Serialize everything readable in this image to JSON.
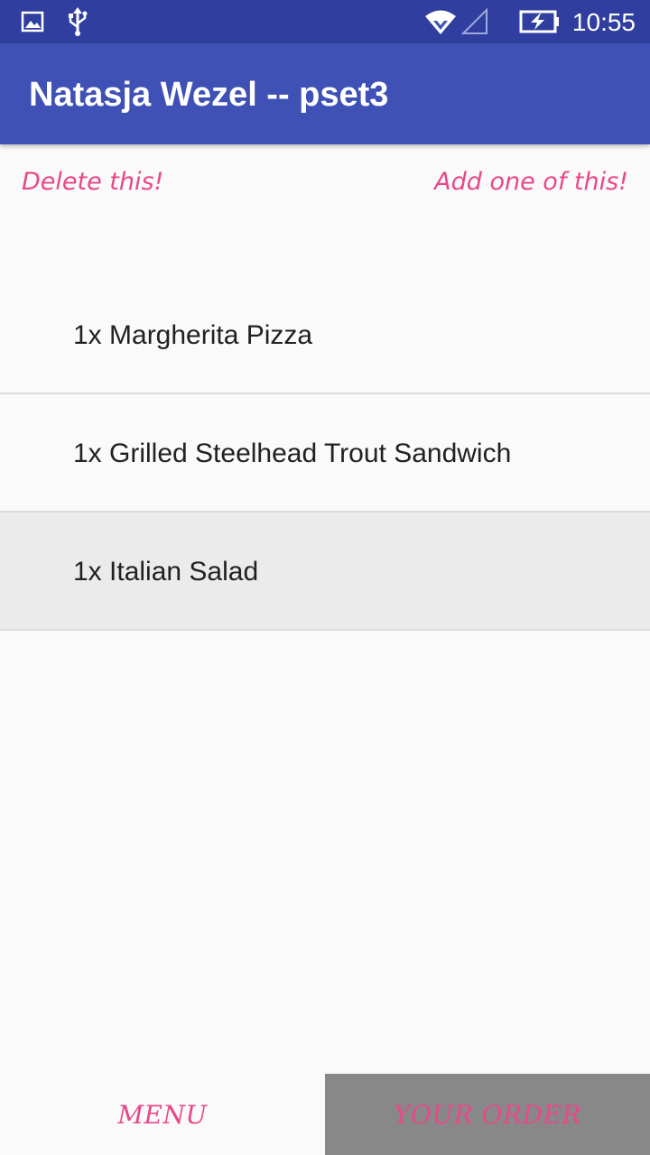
{
  "status_bar": {
    "time": "10:55",
    "icons": [
      "image-icon",
      "usb-icon",
      "wifi-icon",
      "signal-icon",
      "battery-charging-icon"
    ]
  },
  "app_bar": {
    "title": "Natasja Wezel -- pset3"
  },
  "hints": {
    "delete": "Delete this!",
    "add": "Add one of this!"
  },
  "order_list": {
    "items": [
      {
        "label": "1x Margherita Pizza"
      },
      {
        "label": "1x Grilled Steelhead Trout Sandwich"
      },
      {
        "label": "1x Italian Salad"
      }
    ]
  },
  "bottom_nav": {
    "menu_label": "MENU",
    "order_label": "YOUR ORDER"
  },
  "colors": {
    "status_bar": "#303f9f",
    "app_bar": "#3f51b5",
    "accent": "#e8488a",
    "selected_tab_bg": "#888888",
    "selected_row_bg": "#ebebeb"
  }
}
